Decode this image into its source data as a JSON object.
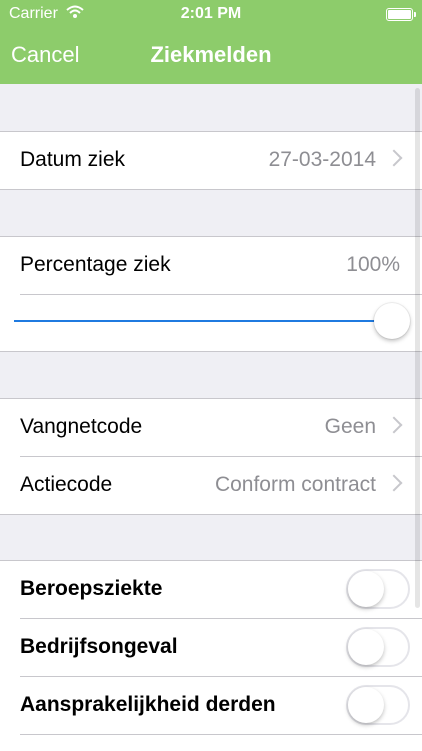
{
  "statusbar": {
    "carrier": "Carrier",
    "time": "2:01 PM"
  },
  "navbar": {
    "cancel_label": "Cancel",
    "title": "Ziekmelden"
  },
  "datum": {
    "label": "Datum ziek",
    "value": "27-03-2014"
  },
  "percentage": {
    "label": "Percentage ziek",
    "value": "100%",
    "slider_level": 1.0
  },
  "codes": {
    "vangnet": {
      "label": "Vangnetcode",
      "value": "Geen"
    },
    "actie": {
      "label": "Actiecode",
      "value": "Conform contract"
    }
  },
  "toggles": [
    {
      "label": "Beroepsziekte",
      "on": false
    },
    {
      "label": "Bedrijfsongeval",
      "on": false
    },
    {
      "label": "Aansprakelijkheid derden",
      "on": false
    }
  ],
  "colors": {
    "accent_green": "#8dcc6b",
    "slider_blue": "#1f7ae0",
    "group_bg": "#efeff4"
  }
}
